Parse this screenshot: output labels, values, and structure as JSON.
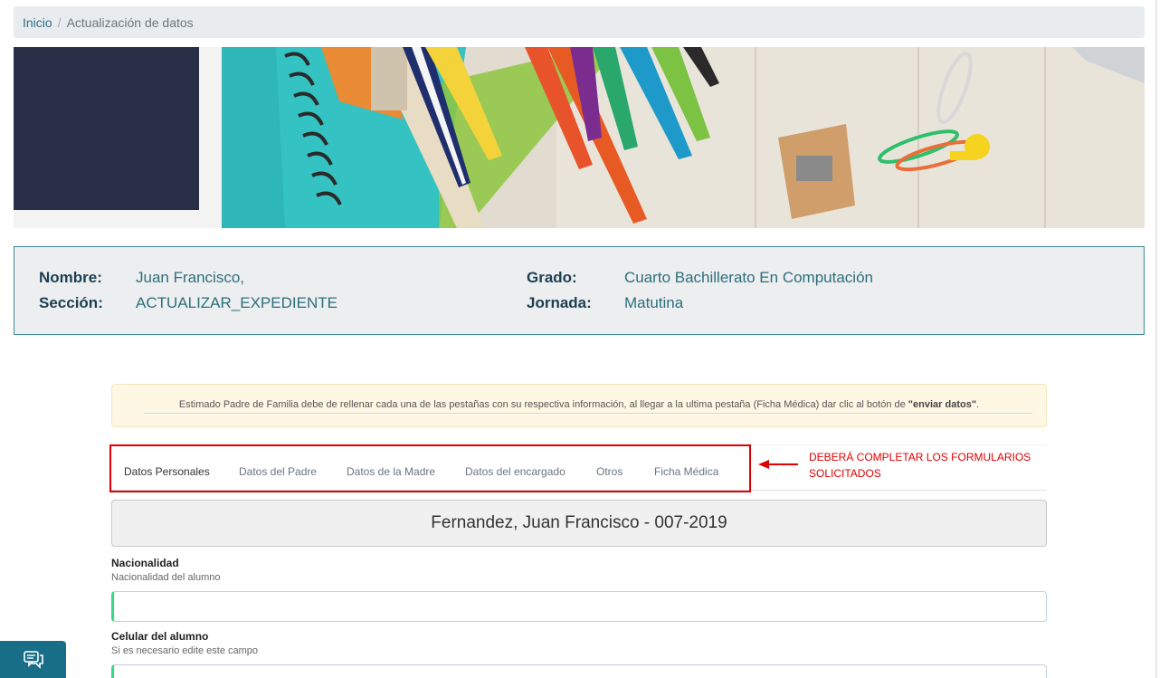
{
  "breadcrumb": {
    "home": "Inicio",
    "separator": "/",
    "current": "Actualización de datos"
  },
  "student_info": {
    "name_label": "Nombre:",
    "name_value": "Juan Francisco,",
    "section_label": "Sección:",
    "section_value": "ACTUALIZAR_EXPEDIENTE",
    "grade_label": "Grado:",
    "grade_value": "Cuarto Bachillerato En Computación",
    "shift_label": "Jornada:",
    "shift_value": "Matutina"
  },
  "notice": {
    "text": "Estimado Padre de Familia debe de rellenar cada una de las pestañas con su respectiva información, al llegar a la ultima pestaña (Ficha Médica) dar clic al botón de ",
    "bold": "\"enviar datos\"",
    "end": "."
  },
  "tabs": [
    {
      "label": "Datos Personales",
      "active": true
    },
    {
      "label": "Datos del Padre",
      "active": false
    },
    {
      "label": "Datos de la Madre",
      "active": false
    },
    {
      "label": "Datos del encargado",
      "active": false
    },
    {
      "label": "Otros",
      "active": false
    },
    {
      "label": "Ficha Médica",
      "active": false
    }
  ],
  "annotation": {
    "line1": "DEBERÁ COMPLETAR LOS FORMULARIOS",
    "line2": "SOLICITADOS"
  },
  "student_card": "Fernandez, Juan Francisco - 007-2019",
  "fields": [
    {
      "label": "Nacionalidad",
      "help": "Nacionalidad del alumno",
      "value": ""
    },
    {
      "label": "Celular del alumno",
      "help": "Si es necesario edite este campo",
      "value": ""
    }
  ],
  "chat_button": {
    "icon": "chat-icon"
  },
  "colors": {
    "accent": "#186e86",
    "highlight_red": "#e00000",
    "input_valid": "#39d98a",
    "info_border": "#3b8a94"
  }
}
